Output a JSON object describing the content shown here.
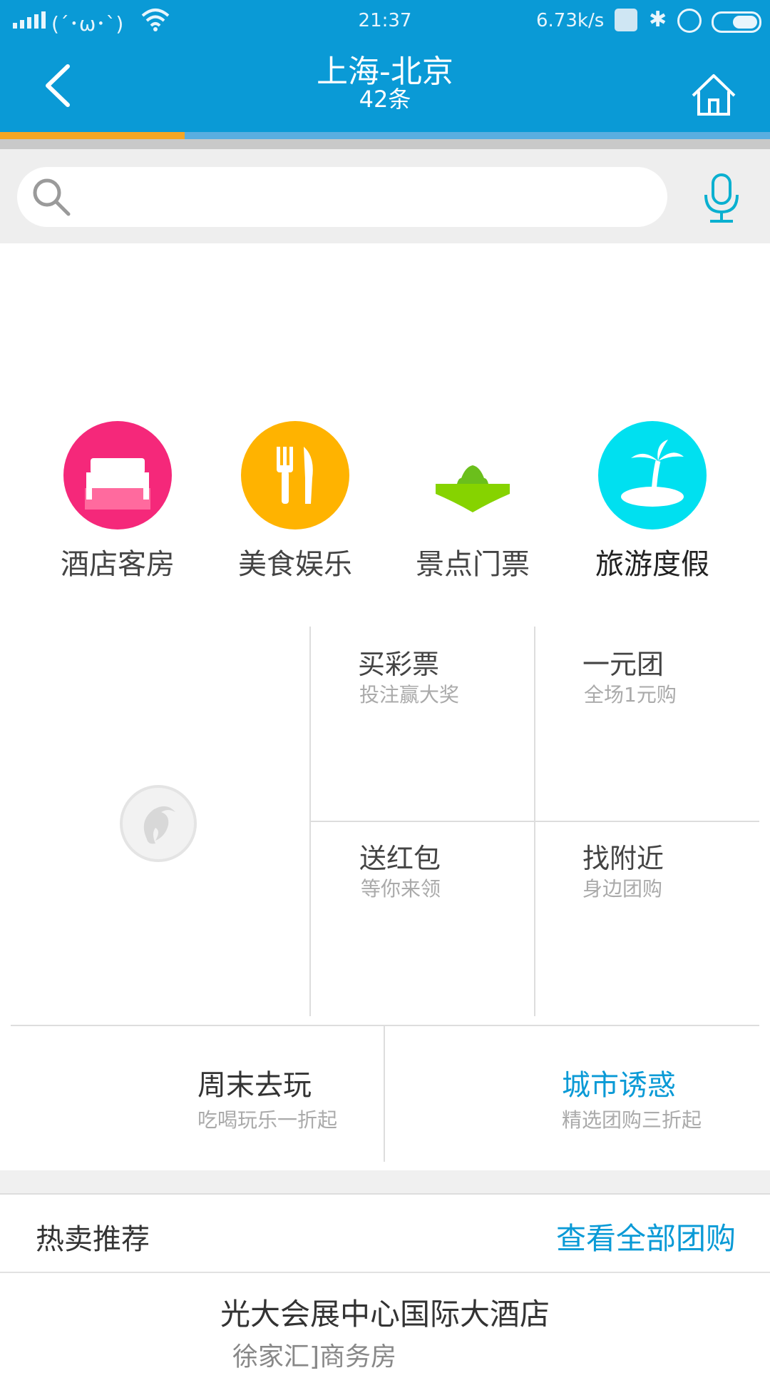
{
  "status_bar": {
    "emoticon": "(´･ω･`)",
    "time": "21:37",
    "speed": "6.73k/s"
  },
  "header": {
    "title": "上海-北京",
    "subtitle": "42条",
    "progress_fraction": 0.24
  },
  "search": {
    "placeholder": ""
  },
  "categories": [
    {
      "label": "酒店客房",
      "icon": "bed-icon",
      "color": "#f5287a"
    },
    {
      "label": "美食娱乐",
      "icon": "fork-knife-icon",
      "color": "#ffb300"
    },
    {
      "label": "景点门票",
      "icon": "ticket-icon",
      "color": "#86d300"
    },
    {
      "label": "旅游度假",
      "icon": "palm-island-icon",
      "color": "#00e0f0"
    }
  ],
  "grid": {
    "cells": [
      {
        "title": "买彩票",
        "sub": "投注赢大奖"
      },
      {
        "title": "一元团",
        "sub": "全场1元购"
      },
      {
        "title": "送红包",
        "sub": "等你来领"
      },
      {
        "title": "找附近",
        "sub": "身边团购"
      }
    ]
  },
  "promos": [
    {
      "title": "周末去玩",
      "sub": "吃喝玩乐一折起",
      "color": "#333333"
    },
    {
      "title": "城市诱惑",
      "sub": "精选团购三折起",
      "color": "#0a9ad6"
    }
  ],
  "hot": {
    "label": "热卖推荐",
    "link": "查看全部团购"
  },
  "listing": {
    "name": "光大会展中心国际大酒店",
    "sub": "徐家汇]商务房"
  },
  "colors": {
    "header": "#0a9ad6",
    "accent": "#f6a623"
  }
}
